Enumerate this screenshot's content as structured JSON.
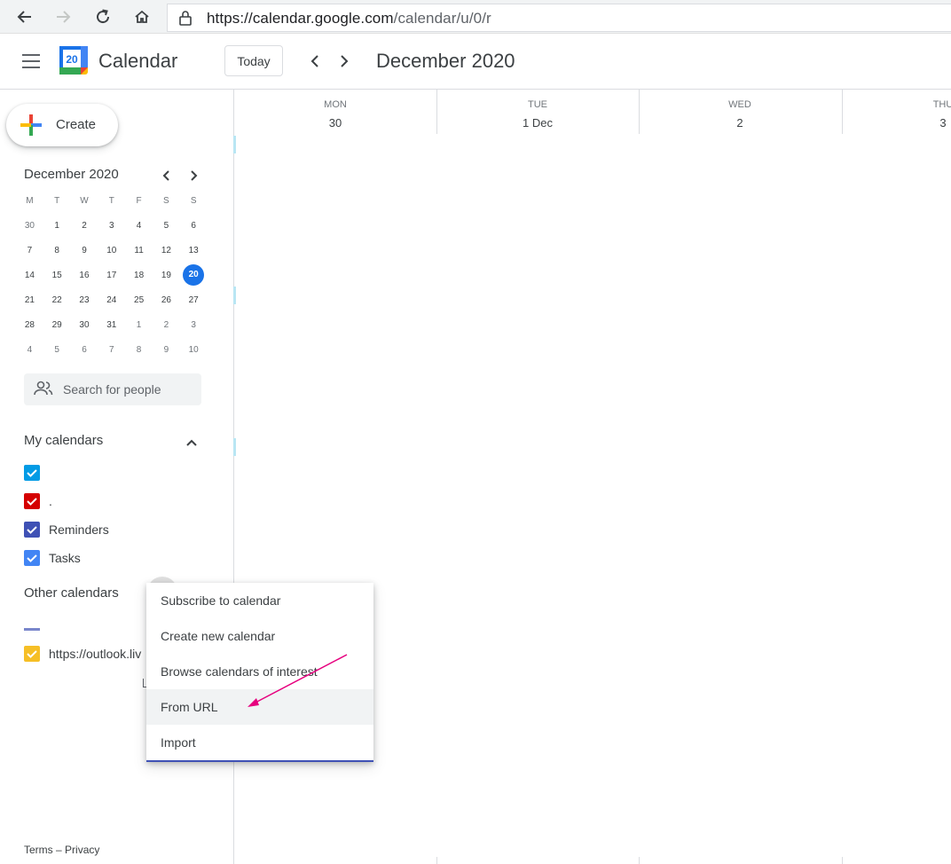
{
  "browser": {
    "url_host": "https://calendar.google.com",
    "url_path": "/calendar/u/0/r"
  },
  "app": {
    "logo_day": "20",
    "name": "Calendar",
    "today_label": "Today",
    "header_title": "December 2020"
  },
  "sidebar": {
    "create_label": "Create",
    "mini_calendar": {
      "title": "December 2020",
      "weekdays": [
        "M",
        "T",
        "W",
        "T",
        "F",
        "S",
        "S"
      ],
      "weeks": [
        [
          "30",
          "1",
          "2",
          "3",
          "4",
          "5",
          "6"
        ],
        [
          "7",
          "8",
          "9",
          "10",
          "11",
          "12",
          "13"
        ],
        [
          "14",
          "15",
          "16",
          "17",
          "18",
          "19",
          "20"
        ],
        [
          "21",
          "22",
          "23",
          "24",
          "25",
          "26",
          "27"
        ],
        [
          "28",
          "29",
          "30",
          "31",
          "1",
          "2",
          "3"
        ],
        [
          "4",
          "5",
          "6",
          "7",
          "8",
          "9",
          "10"
        ]
      ],
      "today": "20"
    },
    "search_placeholder": "Search for people",
    "my_calendars_title": "My calendars",
    "my_calendars": [
      {
        "name": "",
        "color": "#039be5"
      },
      {
        "name": ".",
        "color": "#d50000"
      },
      {
        "name": "Reminders",
        "color": "#3f51b5"
      },
      {
        "name": "Tasks",
        "color": "#4285f4"
      }
    ],
    "other_calendars_title": "Other calendars",
    "other_calendars": [
      {
        "name": "https://outlook.liv",
        "color": "#f6bf26"
      }
    ],
    "footer_terms": "Terms",
    "footer_sep": "–",
    "footer_privacy": "Privacy"
  },
  "week": {
    "days": [
      {
        "dow": "MON",
        "date": "30"
      },
      {
        "dow": "TUE",
        "date": "1 Dec"
      },
      {
        "dow": "WED",
        "date": "2"
      },
      {
        "dow": "THU",
        "date": "3"
      }
    ]
  },
  "menu": {
    "items": [
      "Subscribe to calendar",
      "Create new calendar",
      "Browse calendars of interest",
      "From URL",
      "Import"
    ],
    "highlighted": "From URL"
  },
  "colors": {
    "accent": "#1a73e8",
    "annotation_arrow": "#e6007e"
  }
}
